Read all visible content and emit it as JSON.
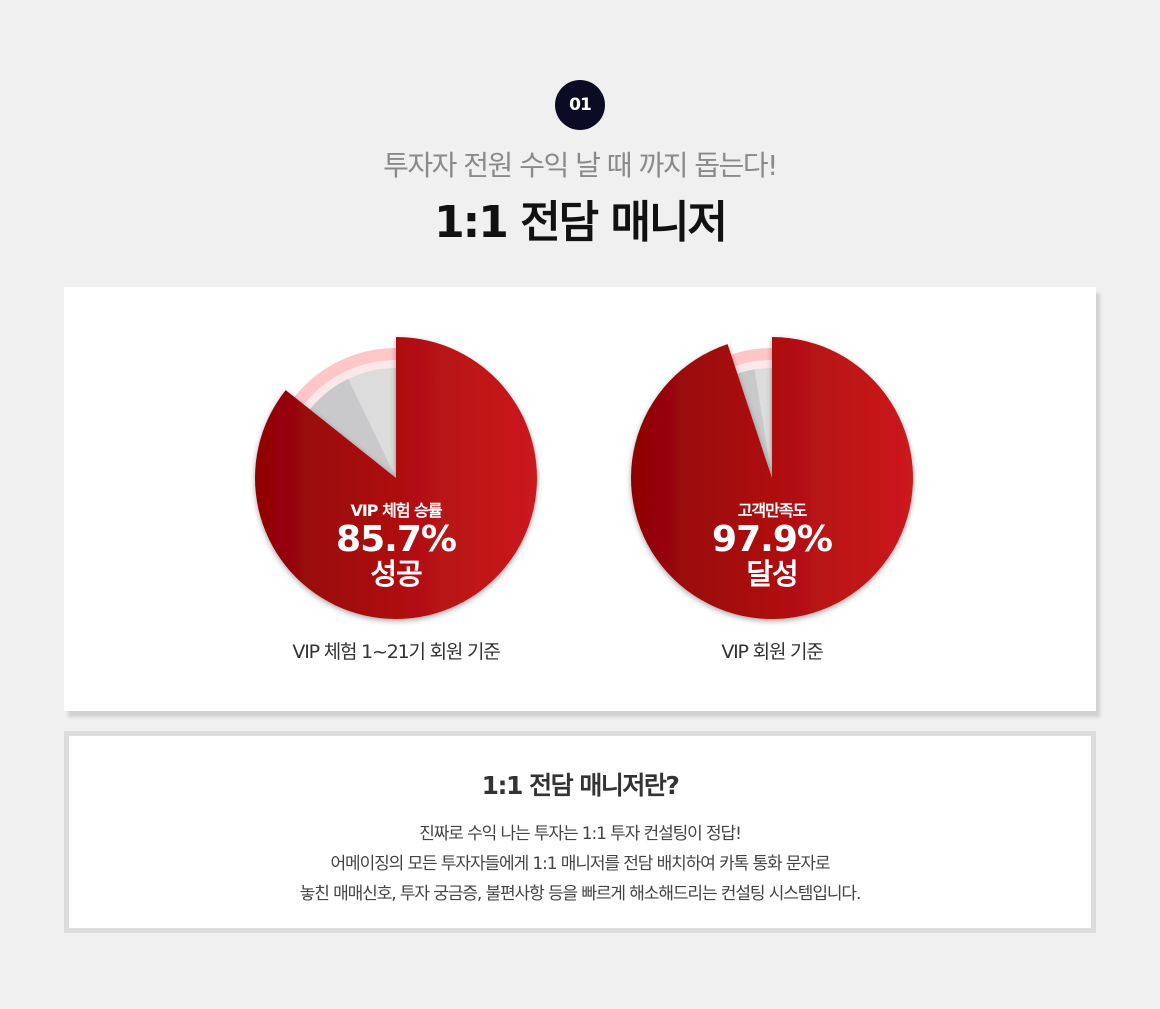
{
  "header": {
    "step": "01",
    "subtitle": "투자자 전원 수익 날 때 까지 돕는다!",
    "title": "1:1 전담 매니저"
  },
  "stats": [
    {
      "label": "VIP 체험 승률",
      "value": "85.7%",
      "sub": "성공",
      "caption": "VIP 체험 1~21기 회원 기준",
      "fraction": 0.857
    },
    {
      "label": "고객만족도",
      "value": "97.9%",
      "sub": "달성",
      "caption": "VIP 회원 기준",
      "fraction": 0.949
    }
  ],
  "info": {
    "title": "1:1 전담 매니저란?",
    "lines": [
      "진짜로 수익 나는 투자는 1:1 투자 컨설팅이 정답!",
      "어메이징의 모든 투자자들에게 1:1 매니저를 전담 배치하여 카톡 통화 문자로",
      "놓친 매매신호, 투자 궁금증, 불편사항 등을 빠르게 해소해드리는 컨설팅 시스템입니다."
    ]
  },
  "colors": {
    "accent_dark": "#8f0305",
    "accent_light": "#cc1a1c",
    "badge": "#0b0c24",
    "pink_ring": "#ffc6c8",
    "gray_slice": "#dcdcdc"
  }
}
